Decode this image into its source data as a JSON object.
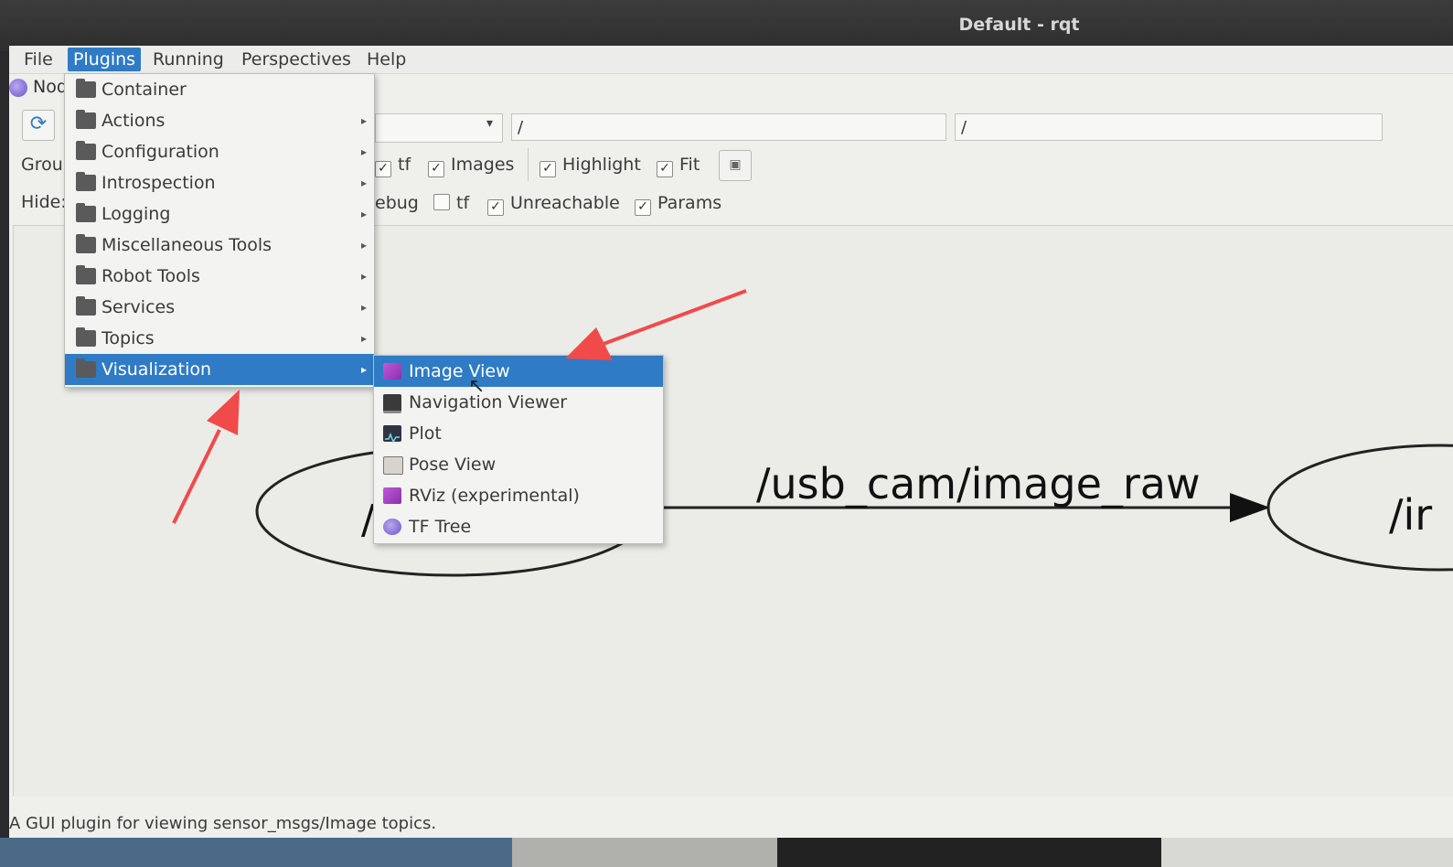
{
  "window": {
    "title": "Default - rqt"
  },
  "menubar": {
    "items": [
      {
        "label": "File"
      },
      {
        "label": "Plugins"
      },
      {
        "label": "Running"
      },
      {
        "label": "Perspectives"
      },
      {
        "label": "Help"
      }
    ]
  },
  "plugin_tab": {
    "label": "Nod"
  },
  "toolbar": {
    "topic_field_1": "/",
    "topic_field_2": "/",
    "group_label": "Grou",
    "hide_label": "Hide:",
    "row1_checks": [
      {
        "label": "tf",
        "checked": true
      },
      {
        "label": "Images",
        "checked": true
      },
      {
        "label": "Highlight",
        "checked": true
      },
      {
        "label": "Fit",
        "checked": true
      }
    ],
    "row2_checks": [
      {
        "label": "ebug",
        "checked": false
      },
      {
        "label": "tf",
        "checked": false
      },
      {
        "label": "Unreachable",
        "checked": true
      },
      {
        "label": "Params",
        "checked": true
      }
    ]
  },
  "plugins_menu": {
    "items": [
      {
        "label": "Container",
        "has_submenu": false
      },
      {
        "label": "Actions",
        "has_submenu": true
      },
      {
        "label": "Configuration",
        "has_submenu": true
      },
      {
        "label": "Introspection",
        "has_submenu": true
      },
      {
        "label": "Logging",
        "has_submenu": true
      },
      {
        "label": "Miscellaneous Tools",
        "has_submenu": true
      },
      {
        "label": "Robot Tools",
        "has_submenu": true
      },
      {
        "label": "Services",
        "has_submenu": true
      },
      {
        "label": "Topics",
        "has_submenu": true
      },
      {
        "label": "Visualization",
        "has_submenu": true,
        "selected": true
      }
    ]
  },
  "visualization_submenu": {
    "items": [
      {
        "label": "Image View",
        "icon": "image-view-icon",
        "selected": true
      },
      {
        "label": "Navigation Viewer",
        "icon": "monitor-icon"
      },
      {
        "label": "Plot",
        "icon": "plot-icon"
      },
      {
        "label": "Pose View",
        "icon": "pose-view-icon"
      },
      {
        "label": "RViz (experimental)",
        "icon": "rviz-icon"
      },
      {
        "label": "TF Tree",
        "icon": "tf-tree-icon"
      }
    ]
  },
  "graph": {
    "edge_label": "/usb_cam/image_raw",
    "left_node_label": "/",
    "right_node_label": "/ir"
  },
  "status": {
    "text": "A GUI plugin for viewing sensor_msgs/Image topics."
  },
  "colors": {
    "highlight": "#2f7bc5",
    "annotation_arrow": "#f04a4a"
  }
}
